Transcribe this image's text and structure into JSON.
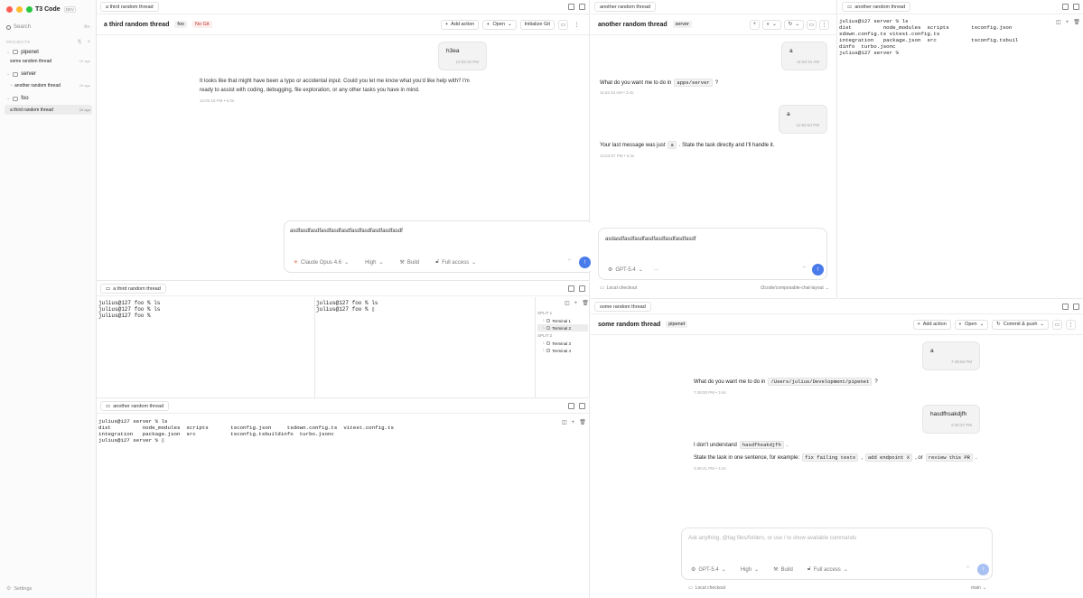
{
  "sidebar": {
    "app_name": "T3 Code",
    "app_tag": "DEV",
    "search_label": "Search",
    "search_shortcut": "⌘K",
    "projects_label": "PROJECTS",
    "projects": [
      {
        "name": "pipenet",
        "threads": [
          {
            "title": "some random thread",
            "age": "1h ago"
          }
        ]
      },
      {
        "name": "server",
        "threads": [
          {
            "title": "another random thread",
            "age": "2d ago"
          }
        ]
      },
      {
        "name": "foo",
        "threads": [
          {
            "title": "a third random thread",
            "age": "2d ago"
          }
        ]
      }
    ],
    "settings_label": "Settings"
  },
  "pane_a": {
    "tab_label": "a third random thread",
    "title": "a third random thread",
    "project_badge": "foo",
    "git_badge": "No Git",
    "add_action": "Add action",
    "open": "Open",
    "init_git": "Initialize Git",
    "user_msg": "h3ea",
    "user_time": "12:02:10 PM",
    "assistant_msg": "It looks like that might have been a typo or accidental input. Could you let me know what you'd like help with? I'm ready to assist with coding, debugging, file exploration, or any other tasks you have in mind.",
    "assistant_meta": "12:02:15 PM • 6.0s",
    "composer_text": "asdfasdfasdfasdfasdfasdfasdfasdfasdfasdfasdf",
    "model": "Claude Opus 4.6",
    "effort": "High",
    "mode": "Build",
    "access": "Full access"
  },
  "term_a": {
    "tab_label": "a third random thread",
    "left_lines": [
      "julius@127 foo % ls",
      "julius@127 foo % ls",
      "julius@127 foo %"
    ],
    "right_lines": [
      "julius@127 foo % ls",
      "julius@127 foo % ▯"
    ],
    "split1": "SPLIT 1",
    "split2": "SPLIT 2",
    "terms1": [
      "Terminal 1",
      "Terminal 2"
    ],
    "terms2": [
      "Terminal 3",
      "Terminal 4"
    ]
  },
  "term_b": {
    "tab_label": "another random thread",
    "lines": [
      "julius@127 server % ls",
      "dist          node_modules  scripts       tsconfig.json     tsdown.config.ts  vitest.config.ts",
      "integration   package.json  src           tsconfig.tsbuildinfo  turbo.jsonc",
      "julius@127 server % ▯"
    ]
  },
  "pane_b": {
    "tab_label": "another random thread",
    "title": "another random thread",
    "project_badge": "server",
    "msg1": "a",
    "msg1_time": "11:52:41 AM",
    "reply1_pre": "What do you want me to do in",
    "reply1_code": "apps/server",
    "reply1_post": "?",
    "reply1_meta": "11:52:44 AM • 3.4s",
    "msg2": "a",
    "msg2_time": "12:52:54 PM",
    "reply2_pre": "Your last message was just",
    "reply2_code": "a",
    "reply2_post": ". State the task directly and I'll handle it.",
    "reply2_meta": "12:52:57 PM • 3.4s",
    "composer_text": "asdasdfasdfasdfasdfasdfasdfasdfasdf",
    "model": "GPT-5.4",
    "checkout": "Local checkout",
    "branch": "t3code/composable-chat-layout"
  },
  "term_c": {
    "tab_label": "another random thread",
    "lines": [
      "julius@127 server % ls",
      "dist          node_modules  scripts       tsconfig.json",
      "sdown.config.ts vitest.config.ts",
      "integration   package.json  src           tsconfig.tsbuil",
      "dinfo  turbo.jsonc",
      "julius@127 server %"
    ]
  },
  "pane_c": {
    "tab_label": "some random thread",
    "title": "some random thread",
    "project_badge": "pipenet",
    "add_action": "Add action",
    "open": "Open",
    "commit": "Commit & push",
    "msg1": "a",
    "msg1_time": "7:48:55 PM",
    "reply1_pre": "What do you want me to do in",
    "reply1_code": "/Users/julius/Development/pipenet",
    "reply1_post": "?",
    "reply1_meta": "7:49:00 PM • 3.4s",
    "msg2": "hasdfhsakdjfh",
    "msg2_time": "2:46:37 PM",
    "reply2_pre": "I don't understand",
    "reply2_code": "hasdfhsakdjfh",
    "reply2_post": ".",
    "reply3_pre": "State the task in one sentence, for example:",
    "ex1": "fix failing tests",
    "ex2": "add endpoint X",
    "ex3": "review this PR",
    "sep1": ",",
    "sep2": ", or",
    "end": ".",
    "reply2_meta": "2:46:41 PM • 3.1s",
    "composer_placeholder": "Ask anything, @tag files/folders, or use / to show available commands",
    "model": "GPT-5.4",
    "effort": "High",
    "mode": "Build",
    "access": "Full access",
    "checkout": "Local checkout",
    "branch": "main"
  }
}
